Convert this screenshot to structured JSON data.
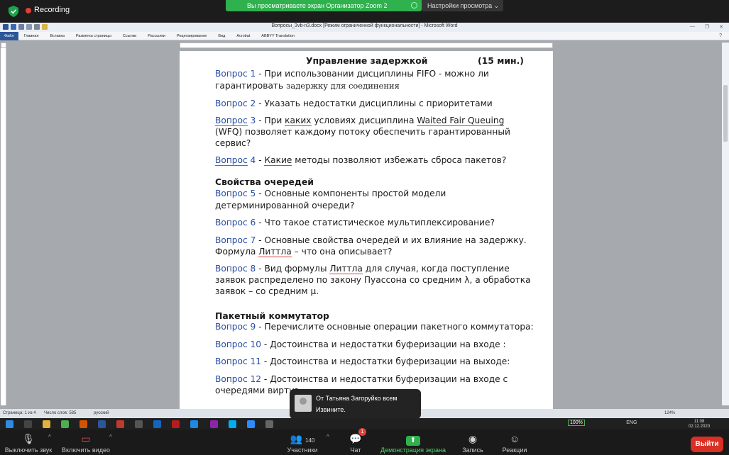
{
  "zoom_top": {
    "recording_label": "Recording",
    "banner_text": "Вы просматриваете экран Организатор Zoom 2",
    "view_options": "Настройки просмотра"
  },
  "word": {
    "title": "Вопросы_3vb-n3.docx [Режим ограниченной функциональности] - Microsoft Word",
    "tabs": [
      "Файл",
      "Главная",
      "Вставка",
      "Разметка страницы",
      "Ссылки",
      "Рассылки",
      "Рецензирование",
      "Вид",
      "Acrobat",
      "ABBYY Translation"
    ],
    "status": {
      "page": "Страница: 1 из 4",
      "words": "Число слов: 585",
      "lang": "русский",
      "zoom": "124%"
    }
  },
  "doc": {
    "title": "Управление задержкой",
    "duration": "(15 мин.)",
    "q1_label": "Вопрос 1",
    "q1_a": " - При использовании дисциплины FIFO  - можно ли",
    "q1_b1": "гарантировать ",
    "q1_b2": "задержку для соединения",
    "q2_label": "Вопрос 2",
    "q2": " - Указать недостатки дисциплины с приоритетами",
    "q3_label": "Вопрос",
    "q3_num": " 3",
    "q3_a1": " - При ",
    "q3_a2": "каких",
    "q3_a3": " условиях дисциплина ",
    "q3_a4": "Waited Fair Queuing",
    "q3_b": "(WFQ) позволяет каждому потоку обеспечить гарантированный",
    "q3_c": "сервис?",
    "q4_label": "Вопрос",
    "q4_num": " 4",
    "q4_a1": " - ",
    "q4_a2": "Какие",
    "q4_a3": " методы позволяют  избежать сброса пакетов?",
    "section2": "Свойства очередей",
    "q5_label": "Вопрос 5",
    "q5_a": " - Основные компоненты простой модели",
    "q5_b": "детерминированной очереди?",
    "q6_label": "Вопрос 6",
    "q6": " - Что такое статистическое мультиплексирование?",
    "q7_label": "Вопрос 7",
    "q7_a": " - Основные свойства очередей и их влияние на задержку.",
    "q7_b1": "Формула ",
    "q7_b2": "Литтла",
    "q7_b3": " – что она описывает?",
    "q8_label": "Вопрос 8",
    "q8_a1": " - Вид формулы ",
    "q8_a2": "Литтла",
    "q8_a3": " для случая, когда поступление",
    "q8_b": "заявок распределено по закону Пуассона со средним λ, а обработка",
    "q8_c": "заявок – со средним μ.",
    "section3": "Пакетный коммутатор",
    "q9_label": "Вопрос 9",
    "q9": " - Перечислите основные операции пакетного коммутатора:",
    "q10_label": "Вопрос 10",
    "q10": " - Достоинства и недостатки буферизации на входе :",
    "q11_label": "Вопрос 11",
    "q11": " - Достоинства и недостатки буферизации на выходе:",
    "q12_label": "Вопрос 12",
    "q12_a": " - Достоинства и недостатки буферизации на входе с",
    "q12_b": "очередями виртуа"
  },
  "toast": {
    "from": "От Татьяна Загоруйко всем",
    "message": "Извините."
  },
  "taskbar": {
    "tray_battery": "100%",
    "lang": "ENG",
    "time": "11:08",
    "date": "02.12.2020"
  },
  "zoom_bottom": {
    "mute": "Выключить звук",
    "video": "Включить видео",
    "participants": "Участники",
    "participants_count": "140",
    "chat": "Чат",
    "chat_badge": "1",
    "share": "Демонстрация экрана",
    "record": "Запись",
    "reactions": "Реакции",
    "leave": "Выйти"
  },
  "colors": {
    "accent_green": "#2fb14e",
    "leave_red": "#d93025",
    "question_blue": "#2b4fa3",
    "word_blue": "#2b579a"
  }
}
